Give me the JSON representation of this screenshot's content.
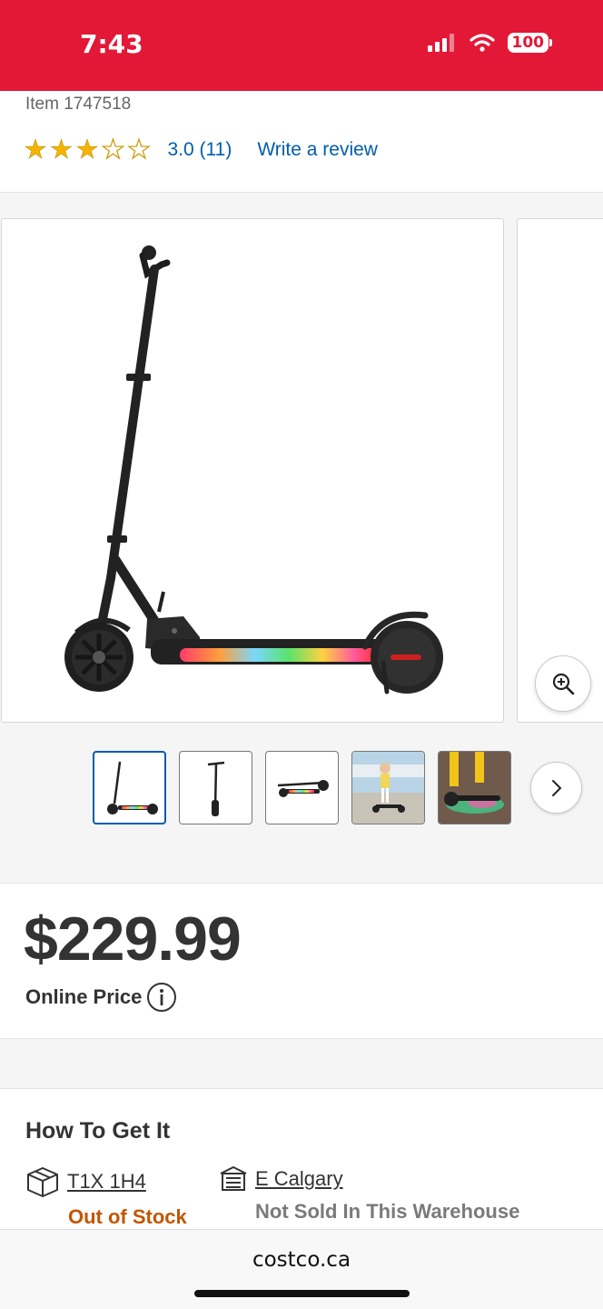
{
  "status": {
    "time": "7:43",
    "battery": "100"
  },
  "product": {
    "item_number": "Item 1747518",
    "rating": 3.0,
    "rating_text": "3.0 (11)",
    "write_review": "Write a review"
  },
  "gallery": {
    "thumb_count": 5,
    "selected_thumb": 1
  },
  "pricing": {
    "price": "$229.99",
    "price_label": "Online Price"
  },
  "availability": {
    "title": "How To Get It",
    "postal_code": "T1X 1H4",
    "shipping_status": "Out of Stock",
    "warehouse": "E Calgary",
    "warehouse_status": "Not Sold In This Warehouse"
  },
  "browser": {
    "url": "costco.ca"
  },
  "colors": {
    "brand_red": "#e31837",
    "link_blue": "#005dab",
    "out_of_stock": "#c45500"
  },
  "icons": [
    "signal-icon",
    "wifi-icon",
    "battery-icon",
    "star-icon",
    "zoom-in-icon",
    "chevron-right-icon",
    "info-icon",
    "box-icon",
    "store-icon"
  ]
}
